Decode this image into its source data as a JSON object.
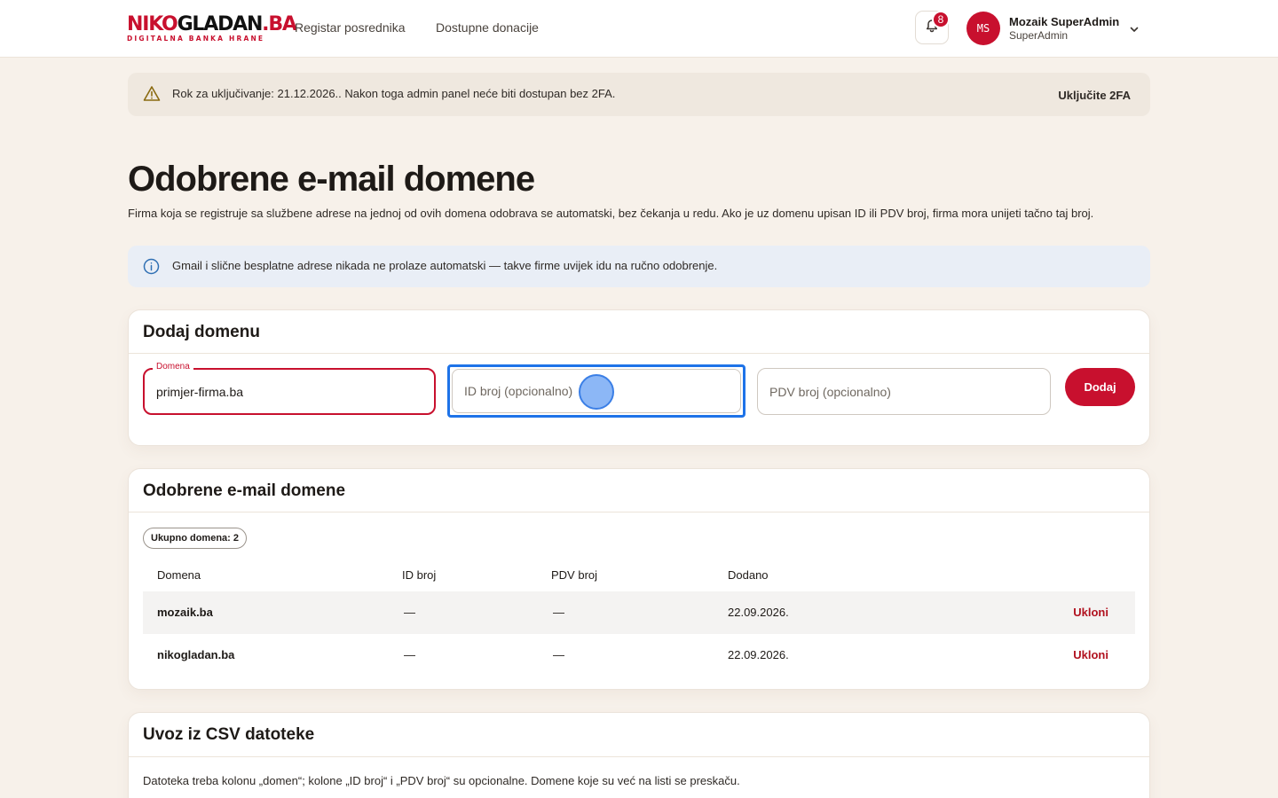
{
  "header": {
    "logo_part1": "NIKO",
    "logo_part2": "GLADAN",
    "logo_part3": ".BA",
    "logo_tagline": "DIGITALNA BANKA HRANE",
    "nav": [
      "Registar posrednika",
      "Dostupne donacije"
    ],
    "notifications_count": "8",
    "user": {
      "initials": "MS",
      "name": "Mozaik SuperAdmin",
      "role": "SuperAdmin"
    }
  },
  "warning": {
    "text": "Rok za uključivanje: 21.12.2026.. Nakon toga admin panel neće biti dostupan bez 2FA.",
    "action": "Uključite 2FA"
  },
  "page": {
    "title": "Odobrene e-mail domene",
    "description": "Firma koja se registruje sa službene adrese na jednoj od ovih domena odobrava se automatski, bez čekanja u redu. Ako je uz domenu upisan ID ili PDV broj, firma mora unijeti tačno taj broj."
  },
  "info": {
    "text": "Gmail i slične besplatne adrese nikada ne prolaze automatski — takve firme uvijek idu na ručno odobrenje."
  },
  "add_form": {
    "title": "Dodaj domenu",
    "domain_label": "Domena",
    "domain_value": "primjer-firma.ba",
    "id_placeholder": "ID broj (opcionalno)",
    "pdv_placeholder": "PDV broj (opcionalno)",
    "submit_label": "Dodaj"
  },
  "domains": {
    "title": "Odobrene e-mail domene",
    "count_label": "Ukupno domena: 2",
    "columns": [
      "Domena",
      "ID broj",
      "PDV broj",
      "Dodano"
    ],
    "rows": [
      {
        "domain": "mozaik.ba",
        "id": "—",
        "pdv": "—",
        "added": "22.09.2026.",
        "action": "Ukloni"
      },
      {
        "domain": "nikogladan.ba",
        "id": "—",
        "pdv": "—",
        "added": "22.09.2026.",
        "action": "Ukloni"
      }
    ]
  },
  "csv": {
    "title": "Uvoz iz CSV datoteke",
    "description": "Datoteka treba kolonu „domen“; kolone „ID broj“ i „PDV broj“ su opcionalne. Domene koje su već na listi se preskaču."
  },
  "colors": {
    "brand": "#c8102e",
    "background": "#f7f1ea",
    "focus": "#1e73e8"
  }
}
